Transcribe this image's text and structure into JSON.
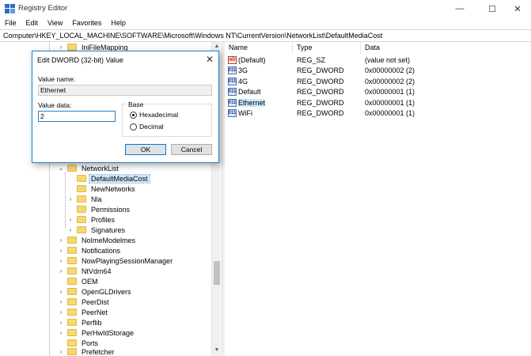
{
  "window": {
    "title": "Registry Editor",
    "minimize_glyph": "—",
    "maximize_glyph": "☐",
    "close_glyph": "✕"
  },
  "menu": [
    "File",
    "Edit",
    "View",
    "Favorites",
    "Help"
  ],
  "address": "Computer\\HKEY_LOCAL_MACHINE\\SOFTWARE\\Microsoft\\Windows NT\\CurrentVersion\\NetworkList\\DefaultMediaCost",
  "tree": {
    "items": [
      {
        "label": "IniFileMapping",
        "chevron": "›"
      },
      {
        "label": "NetworkList",
        "chevron": "⌄"
      },
      {
        "label": "DefaultMediaCost",
        "chevron": ""
      },
      {
        "label": "NewNetworks",
        "chevron": ""
      },
      {
        "label": "Nla",
        "chevron": "›"
      },
      {
        "label": "Permissions",
        "chevron": ""
      },
      {
        "label": "Profiles",
        "chevron": "›"
      },
      {
        "label": "Signatures",
        "chevron": "›"
      },
      {
        "label": "NoImeModelmes",
        "chevron": "›"
      },
      {
        "label": "Notifications",
        "chevron": "›"
      },
      {
        "label": "NowPlayingSessionManager",
        "chevron": "›"
      },
      {
        "label": "NtVdm64",
        "chevron": "›"
      },
      {
        "label": "OEM",
        "chevron": ""
      },
      {
        "label": "OpenGLDrivers",
        "chevron": "›"
      },
      {
        "label": "PeerDist",
        "chevron": "›"
      },
      {
        "label": "PeerNet",
        "chevron": "›"
      },
      {
        "label": "Perflib",
        "chevron": "›"
      },
      {
        "label": "PerHwIdStorage",
        "chevron": "›"
      },
      {
        "label": "Ports",
        "chevron": ""
      },
      {
        "label": "Prefetcher",
        "chevron": "›"
      }
    ]
  },
  "scrollbar": {
    "up_glyph": "▲",
    "down_glyph": "▼"
  },
  "list": {
    "headers": [
      "Name",
      "Type",
      "Data"
    ],
    "rows": [
      {
        "icon": "ab",
        "name": "(Default)",
        "type": "REG_SZ",
        "data": "(value not set)"
      },
      {
        "icon": "011",
        "name": "3G",
        "type": "REG_DWORD",
        "data": "0x00000002 (2)"
      },
      {
        "icon": "011",
        "name": "4G",
        "type": "REG_DWORD",
        "data": "0x00000002 (2)"
      },
      {
        "icon": "011",
        "name": "Default",
        "type": "REG_DWORD",
        "data": "0x00000001 (1)"
      },
      {
        "icon": "011",
        "name": "Ethernet",
        "type": "REG_DWORD",
        "data": "0x00000001 (1)"
      },
      {
        "icon": "011",
        "name": "WiFi",
        "type": "REG_DWORD",
        "data": "0x00000001 (1)"
      }
    ]
  },
  "dialog": {
    "title": "Edit DWORD (32-bit) Value",
    "close_glyph": "✕",
    "value_name_label": "Value name:",
    "value_name": "Ethernet",
    "value_data_label": "Value data:",
    "value_data": "2",
    "base_label": "Base",
    "hex_label": "Hexadecimal",
    "dec_label": "Decimal",
    "ok_label": "OK",
    "cancel_label": "Cancel"
  }
}
